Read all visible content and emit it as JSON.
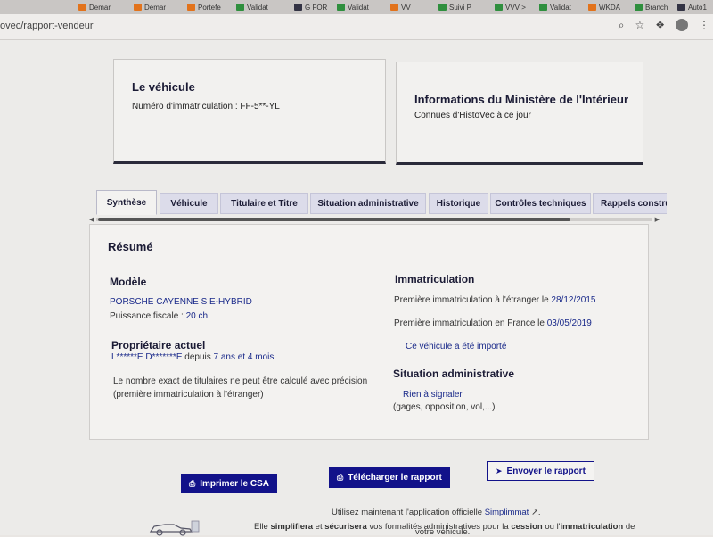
{
  "browser": {
    "tabs": [
      {
        "label": "Demar",
        "color": "orange"
      },
      {
        "label": "Demar",
        "color": "orange"
      },
      {
        "label": "Portefe",
        "color": "orange"
      },
      {
        "label": "Validat",
        "color": "green"
      },
      {
        "label": "G FOR",
        "color": "dark"
      },
      {
        "label": "Validat",
        "color": "green"
      },
      {
        "label": "VV",
        "color": "orange"
      },
      {
        "label": "Suivi P",
        "color": "green"
      },
      {
        "label": "VVV >",
        "color": "green"
      },
      {
        "label": "Validat",
        "color": "green"
      },
      {
        "label": "WKDA",
        "color": "orange"
      },
      {
        "label": "Branch",
        "color": "green"
      },
      {
        "label": "Auto1",
        "color": "dark"
      }
    ],
    "url": "ovec/rapport-vendeur"
  },
  "vehicle_card": {
    "title": "Le véhicule",
    "plate_text": "Numéro d'immatriculation : FF-5**-YL"
  },
  "ministry_card": {
    "title": "Informations du Ministère de l'Intérieur",
    "subtitle": "Connues d'HistoVec à ce jour"
  },
  "tabs": [
    {
      "label": "Synthèse",
      "active": true
    },
    {
      "label": "Véhicule",
      "active": false
    },
    {
      "label": "Titulaire et Titre",
      "active": false
    },
    {
      "label": "Situation administrative",
      "active": false
    },
    {
      "label": "Historique",
      "active": false
    },
    {
      "label": "Contrôles techniques",
      "active": false
    },
    {
      "label": "Rappels constru",
      "active": false
    }
  ],
  "summary": {
    "title": "Résumé",
    "model_heading": "Modèle",
    "model_name": "PORSCHE CAYENNE S E-HYBRID",
    "fiscal_label": "Puissance fiscale : ",
    "fiscal_value": "20 ch",
    "owner_heading": "Propriétaire actuel",
    "owner_name": "L******E D*******E",
    "owner_since_label": " depuis ",
    "owner_since_value": "7 ans et 4 mois",
    "owners_note_line1": "Le nombre exact de titulaires ne peut être calculé avec précision",
    "owners_note_line2": "(première immatriculation à l'étranger)",
    "immat_heading": "Immatriculation",
    "first_foreign_label": "Première immatriculation à l'étranger le ",
    "first_foreign_date": "28/12/2015",
    "first_france_label": "Première immatriculation en France le ",
    "first_france_date": "03/05/2019",
    "imported_text": "Ce véhicule a été importé",
    "admin_heading": "Situation administrative",
    "admin_status": "Rien à signaler",
    "admin_detail": "(gages, opposition, vol,...)"
  },
  "actions": {
    "print_label": "Imprimer le CSA",
    "download_label": "Télécharger le rapport",
    "send_label": "Envoyer le rapport"
  },
  "footer": {
    "line1_before": "Utilisez maintenant l'application officielle ",
    "line1_link": "Simplimmat",
    "line1_after": ".",
    "line2_a": "Elle ",
    "line2_b": "simplifiera",
    "line2_c": " et ",
    "line2_d": "sécurisera",
    "line2_e": " vos formalités administratives pour la ",
    "line2_f": "cession",
    "line2_g": " ou l'",
    "line2_h": "immatriculation",
    "line2_i": " de",
    "line3": "votre véhicule."
  }
}
